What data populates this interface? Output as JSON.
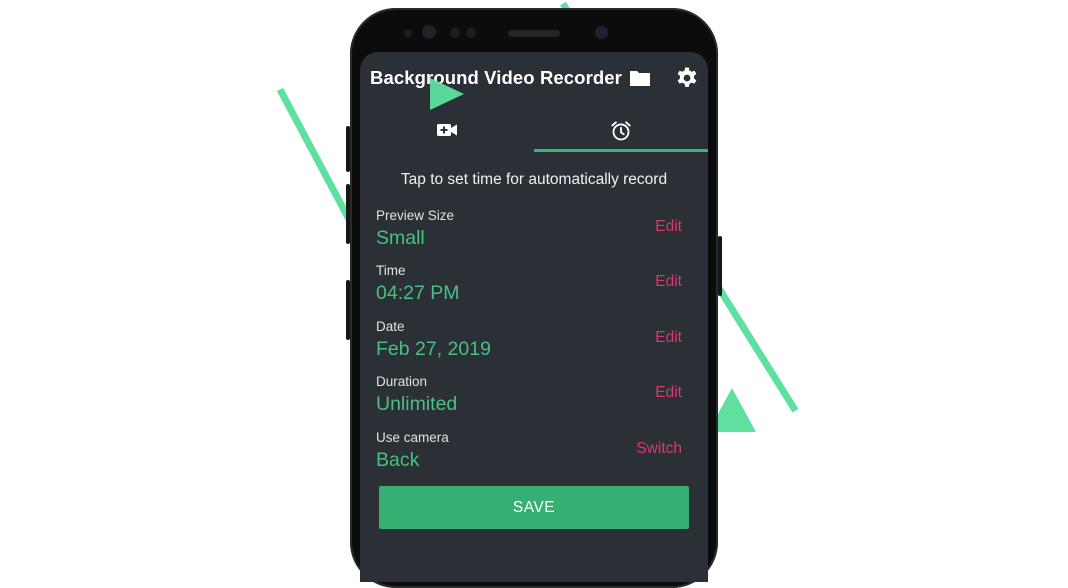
{
  "app": {
    "title": "Background Video Recorder",
    "icons": {
      "folder": "folder-icon",
      "settings": "gear-icon"
    }
  },
  "tabs": [
    {
      "icon": "video-camera-icon",
      "selected": false
    },
    {
      "icon": "alarm-clock-icon",
      "selected": true
    }
  ],
  "schedule": {
    "hint": "Tap to set time for automatically record",
    "rows": [
      {
        "label": "Preview Size",
        "value": "Small",
        "action": "Edit"
      },
      {
        "label": "Time",
        "value": "04:27 PM",
        "action": "Edit"
      },
      {
        "label": "Date",
        "value": "Feb 27, 2019",
        "action": "Edit"
      },
      {
        "label": "Duration",
        "value": "Unlimited",
        "action": "Edit"
      },
      {
        "label": "Use camera",
        "value": "Back",
        "action": "Switch"
      }
    ],
    "save_label": "SAVE"
  },
  "colors": {
    "screen_bg": "#2b3036",
    "accent_green": "#36b072",
    "value_green": "#47c081",
    "action_pink": "#e0356f",
    "decor_green": "#5fe0a0"
  }
}
